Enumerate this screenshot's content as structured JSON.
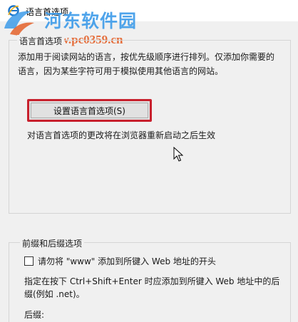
{
  "window": {
    "title": "语言首选项"
  },
  "watermark": {
    "name": "河东软件园",
    "url": "www.pc0359.cn"
  },
  "language_group": {
    "legend": "语言首选项",
    "description_line1": "添加用于阅读网站的语言，按优先级顺序进行排列。仅添加你需要的",
    "description_line2": "语言，因为某些字符可用于模拟使用其他语言的网站。",
    "button_label": "设置语言首选项(S)",
    "restart_note": "对语言首选项的更改将在浏览器重新启动之后生效"
  },
  "prefix_group": {
    "legend": "前缀和后缀选项",
    "checkbox_label": "请勿将 \"www\" 添加到所键入 Web 地址的开头",
    "checkbox_checked": false,
    "hint_line1": "指定在按下 Ctrl+Shift+Enter 时应添加到所键入 Web 地址中的后",
    "hint_line2": "缀(例如 .net)。",
    "suffix_label": "后缀:"
  },
  "colors": {
    "highlight_border": "#c8202d",
    "watermark_blue": "#3d9be9",
    "watermark_orange": "#e4622a"
  },
  "icons": {
    "app": "ie-icon",
    "watermark": "watermark-logo-icon",
    "cursor": "mouse-cursor-icon"
  }
}
